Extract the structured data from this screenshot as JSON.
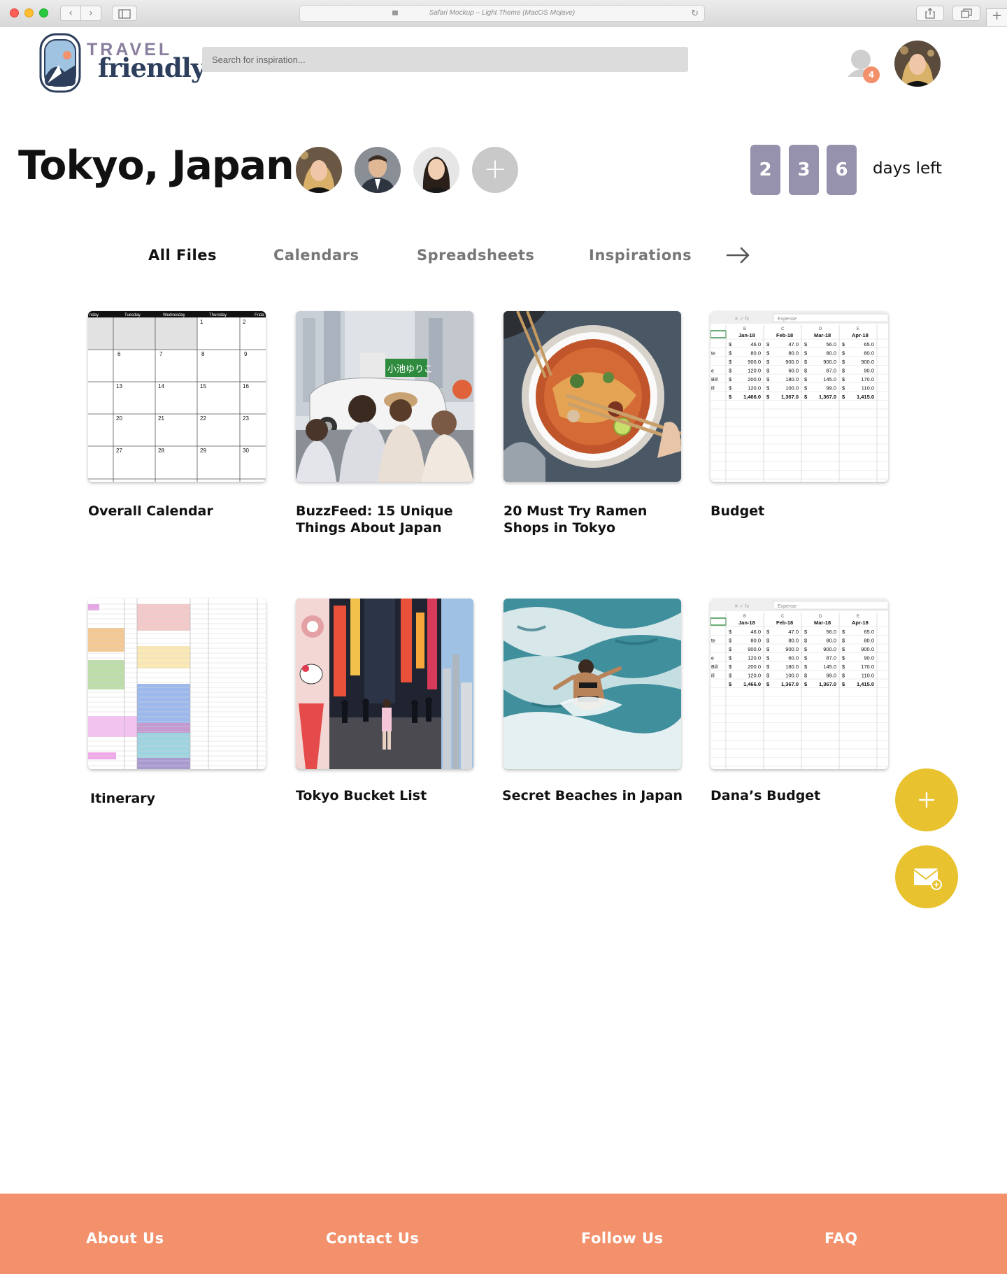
{
  "browser": {
    "address_text": "Safari Mockup – Light Theme (MacOS Mojave)",
    "back_icon": "chevron-left-icon",
    "forward_icon": "chevron-right-icon",
    "back_glyph": "‹",
    "forward_glyph": "›",
    "reload_glyph": "↻",
    "new_tab_glyph": "+"
  },
  "header": {
    "logo_line1": "TRAVEL",
    "logo_line2": "friendly",
    "search_placeholder": "Search for inspiration...",
    "notification_count": "4"
  },
  "trip": {
    "title": "Tokyo, Japan",
    "add_member_label": "+",
    "countdown_digits": [
      "2",
      "3",
      "6"
    ],
    "countdown_label": "days left"
  },
  "tabs": [
    {
      "label": "All Files",
      "active": true
    },
    {
      "label": "Calendars",
      "active": false
    },
    {
      "label": "Spreadsheets",
      "active": false
    },
    {
      "label": "Inspirations",
      "active": false
    }
  ],
  "files": [
    {
      "title": "Overall Calendar",
      "thumb": "calendar"
    },
    {
      "title": "BuzzFeed: 15 Unique Things About Japan",
      "thumb": "street"
    },
    {
      "title": "20 Must Try Ramen Shops in Tokyo",
      "thumb": "ramen"
    },
    {
      "title": "Budget",
      "thumb": "spreadsheet"
    },
    {
      "title": "Itinerary",
      "thumb": "itinerary"
    },
    {
      "title": "Tokyo Bucket List",
      "thumb": "collage"
    },
    {
      "title": "Secret Beaches in Japan",
      "thumb": "ocean"
    },
    {
      "title": "Dana’s Budget",
      "thumb": "spreadsheet"
    }
  ],
  "calendar": {
    "weekdays": [
      "nday",
      "Tuesday",
      "Wednesday",
      "Thursday",
      "Frida"
    ],
    "weeks": [
      [
        "",
        "",
        "",
        "1",
        "2"
      ],
      [
        "6",
        "7",
        "8",
        "9",
        ""
      ],
      [
        "13",
        "14",
        "15",
        "16",
        ""
      ],
      [
        "20",
        "21",
        "22",
        "23",
        ""
      ],
      [
        "27",
        "28",
        "29",
        "30",
        ""
      ]
    ]
  },
  "spreadsheet": {
    "formula_text": "Expense",
    "col_letters": [
      "B",
      "C",
      "D",
      "E"
    ],
    "months": [
      "Jan-18",
      "Feb-18",
      "Mar-18",
      "Apr-18"
    ],
    "row_labels": [
      "",
      "te",
      "",
      "e",
      "Bill",
      "ill",
      ""
    ],
    "rows": [
      [
        "46.0",
        "47.0",
        "56.0",
        "65.0"
      ],
      [
        "80.0",
        "80.0",
        "80.0",
        "80.0"
      ],
      [
        "900.0",
        "900.0",
        "900.0",
        "900.0"
      ],
      [
        "120.0",
        "60.0",
        "87.0",
        "90.0"
      ],
      [
        "200.0",
        "180.0",
        "145.0",
        "170.0"
      ],
      [
        "120.0",
        "100.0",
        "99.0",
        "110.0"
      ],
      [
        "1,466.0",
        "1,367.0",
        "1,367.0",
        "1,415.0"
      ]
    ]
  },
  "street_sign": "小池ゆりこ",
  "footer": {
    "links": [
      "About Us",
      "Contact Us",
      "Follow Us",
      "FAQ"
    ]
  },
  "colors": {
    "accent_purple": "#9691ac",
    "fab_yellow": "#e8c22f",
    "footer_orange": "#f2916c",
    "badge_orange": "#f2906b"
  },
  "icons": {
    "notification": "bell-icon",
    "tab_arrow": "arrow-right-icon",
    "fab_add": "plus-icon",
    "fab_mail": "envelope-plus-icon"
  }
}
